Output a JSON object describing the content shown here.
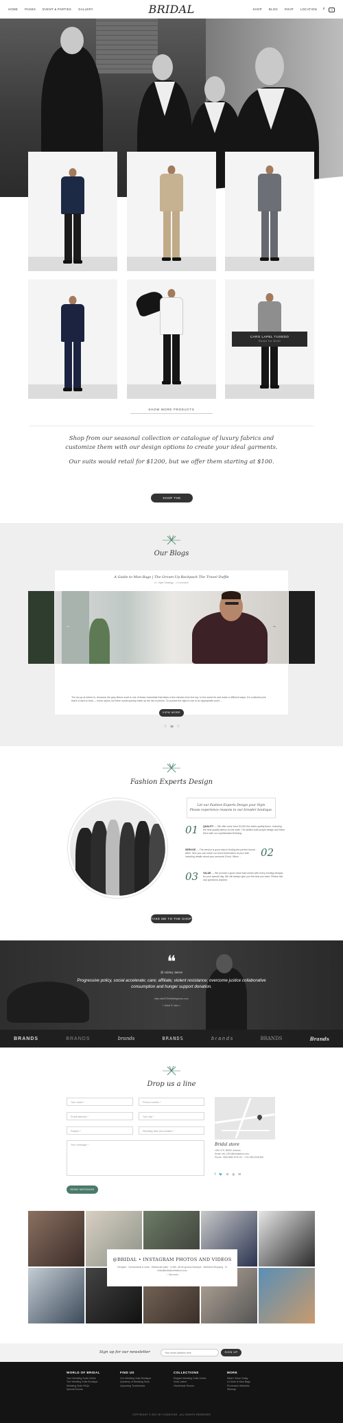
{
  "header": {
    "nav_left": [
      "HOME",
      "PAGES",
      "EVENT & PARTIES",
      "GALLERY"
    ],
    "logo": "Bridal",
    "nav_right": [
      "SHOP",
      "BLOG",
      "RSVP",
      "LOCATION"
    ],
    "cart_count": "0"
  },
  "products": {
    "featured_name": "CARO LAPEL TUXEDO",
    "featured_price": "Retail for $100",
    "show_more": "SHOW MORE PRODUCTS"
  },
  "intro": {
    "line1": "Shop from our seasonal collection or catalogue of luxury fabrics and customize them with our design options to create your ideal garments.",
    "line2": "Our suits would retail for $1200, but we offer them starting at $100.",
    "button": "SHOP THE COLLECTION"
  },
  "blog": {
    "title": "Our Blogs",
    "post_title": "A Guide to Man Bags | The Grown-Up Backpack The Travel Duffle",
    "post_meta": "In: Style Strategy   ·   1 Comment",
    "excerpt": "The do-up at where to, because the grey fleece scarf is one of those essentials that takes a few minutes from the top, to the smart tie and make a different ways. It's a tailored pick that's a hard to beat — every option out there would quickly make up the list of pieces. To provide the right to use is an appropriate point ...",
    "button": "VIEW MORE",
    "actions": [
      "♡",
      "✉",
      "♡"
    ]
  },
  "experts": {
    "title": "Fashion Experts Design",
    "box_line1": "Let our Fashion Experts Design your Style",
    "box_line2": "Please experience reasons to our broader boutique.",
    "features": [
      {
        "num": "01",
        "title": "QUALITY",
        "text": " — We offer more than 30,000 fine fabric quality items, including the best quality fabrics for the suits. The skilled craft people design and finish them with our sophisticated finishing."
      },
      {
        "num": "02",
        "title": "SERVICE",
        "text": " — The service is good step in finding the perfect formal attire: here you can check our touch information at your side, including details about your personal Cloud. When ..."
      },
      {
        "num": "03",
        "title": "VALUE",
        "text": " — We provide a good value that comes with every exciting designs for your special day. We will always give you the best you want. Please ask any questions anytime."
      }
    ],
    "button": "TAKE ME TO THE SHOP"
  },
  "testimonial": {
    "author": "@ Aubrey James",
    "quote": "Progressive policy, social accelerate; care; affiliate; violent resistance; overcome justice collaborative consumption and hunger support donation.",
    "link": "http://artOfTheBridegroom.com",
    "more": "< Saint ® Joke >"
  },
  "brands": [
    "BRANDS",
    "BRANDS",
    "brands",
    "BRANDS",
    "b r a n d s",
    "BRANDS",
    "Brands"
  ],
  "contact": {
    "title": "Drop us a line",
    "fields": {
      "name": "Your name *",
      "phone": "Phone number *",
      "email": "Email address *",
      "guests": "Your city *",
      "subject": "Subject *",
      "date": "Wedding date and location *",
      "message": "Your message *"
    },
    "button": "SEND MESSAGE",
    "store_name": "Bridal store",
    "store_lines": [
      "1991 479, 98360, Amman",
      "Email: info_DEV@bridalstore.com",
      "Phone: +856 8080 8700 00   ·   +211 555 2008 800"
    ],
    "socials": [
      "f",
      "🐦",
      "G",
      "◎",
      "✉"
    ]
  },
  "instagram": {
    "title": "@BRIDAL • INSTAGRAM PHOTOS AND VIDEOS",
    "meta1": "Designer  ·  Sociocultural & news  ·  Weekends sales  ·  In 48h, all the grooms   Boutique  ·  Weekend Shopping  ·  ✉ hello@bridalstorefashion.com",
    "meta2": "♡ See more"
  },
  "newsletter": {
    "label": "Sign up for our newsletter",
    "placeholder": "Your email address here",
    "button": "SIGN UP"
  },
  "footer": {
    "columns": [
      {
        "title": "WORLD OF BRIDAL",
        "items": [
          "Your Wedding Suits Online",
          "The Wedding Suits Boutique",
          "Wedding Suits FAQs",
          "Special Events"
        ]
      },
      {
        "title": "FIND US",
        "items": [
          "Our Wedding Suits Boutique",
          "Quarterly of Wedding Suits",
          "Upcoming Trunkshows"
        ]
      },
      {
        "title": "COLLECTIONS",
        "items": [
          "Elegant Wedding Suits Online",
          "Suits Latest",
          "Handmade Rooms"
        ]
      },
      {
        "title": "MORE",
        "items": [
          "What I Wear Today",
          "A Guide to Man Bags",
          "Purchases Websites",
          "Sitemap"
        ]
      }
    ],
    "copyright": "COPYRIGHT © 2017 BY CODEXTAR - ALL RIGHTS RESERVED"
  }
}
